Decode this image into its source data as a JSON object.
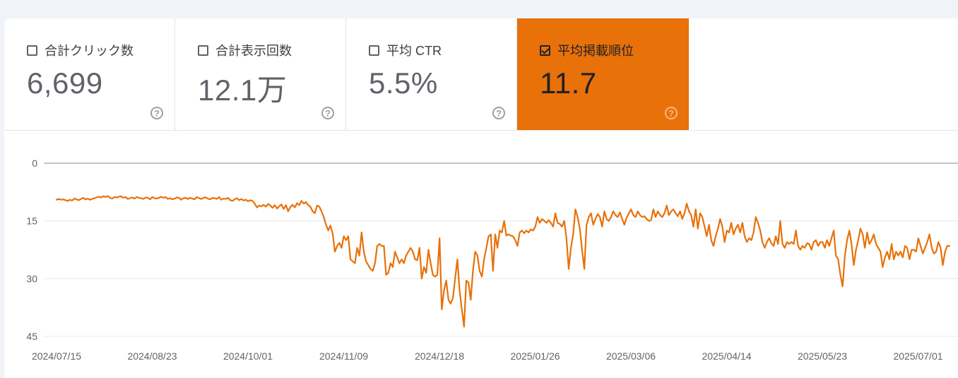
{
  "tiles": [
    {
      "label": "合計クリック数",
      "value": "6,699",
      "checked": false
    },
    {
      "label": "合計表示回数",
      "value": "12.1万",
      "checked": false
    },
    {
      "label": "平均 CTR",
      "value": "5.5%",
      "checked": false
    },
    {
      "label": "平均掲載順位",
      "value": "11.7",
      "checked": true
    }
  ],
  "help_glyph": "?",
  "colors": {
    "accent": "#e8710a",
    "line": "#e8710a"
  },
  "chart_data": {
    "type": "line",
    "title": "",
    "xlabel": "",
    "ylabel": "",
    "y_reversed": true,
    "ylim": [
      0,
      45
    ],
    "y_ticks": [
      "0",
      "15",
      "30",
      "45"
    ],
    "x_ticks": [
      "2024/07/15",
      "2024/08/23",
      "2024/10/01",
      "2024/11/09",
      "2024/12/18",
      "2025/01/26",
      "2025/03/06",
      "2025/04/14",
      "2025/05/23",
      "2025/07/01"
    ],
    "grid": true,
    "series": [
      {
        "values": [
          9.5,
          9.3,
          9.5,
          9.4,
          9.6,
          9.8,
          9.5,
          9.7,
          9.2,
          9.4,
          9.6,
          9.3,
          9.0,
          9.4,
          9.2,
          9.5,
          9.3,
          9.1,
          8.9,
          8.7,
          8.9,
          8.6,
          8.8,
          8.5,
          9.0,
          9.2,
          8.8,
          8.9,
          8.7,
          8.6,
          9.0,
          8.8,
          9.3,
          9.1,
          8.9,
          9.2,
          8.8,
          9.0,
          9.1,
          9.3,
          8.9,
          9.0,
          9.4,
          8.8,
          9.1,
          9.2,
          9.0,
          8.7,
          9.0,
          8.8,
          9.3,
          9.1,
          9.4,
          9.2,
          8.9,
          9.0,
          9.5,
          9.1,
          9.0,
          9.3,
          9.0,
          9.2,
          9.4,
          8.8,
          9.1,
          9.3,
          9.0,
          8.9,
          9.2,
          9.4,
          9.0,
          9.1,
          9.3,
          8.8,
          9.5,
          9.2,
          9.3,
          9.0,
          9.6,
          9.8,
          9.4,
          9.1,
          9.6,
          9.3,
          9.7,
          9.5,
          9.9,
          9.6,
          9.8,
          10.5,
          11.5,
          11.0,
          11.2,
          10.8,
          11.3,
          10.6,
          11.0,
          11.6,
          10.9,
          11.8,
          11.2,
          10.7,
          11.9,
          10.9,
          12.5,
          11.4,
          10.8,
          11.5,
          10.4,
          10.9,
          9.8,
          10.5,
          10.1,
          10.9,
          11.3,
          12.5,
          13.0,
          11.0,
          11.3,
          12.5,
          14.0,
          16.0,
          17.5,
          16.2,
          18.3,
          23.0,
          21.5,
          20.7,
          22.0,
          19.0,
          20.0,
          19.0,
          25.0,
          25.5,
          26.0,
          22.0,
          24.0,
          18.0,
          23.0,
          25.5,
          26.5,
          27.5,
          28.0,
          26.0,
          21.5,
          21.0,
          21.5,
          21.5,
          29.0,
          28.5,
          26.0,
          27.0,
          23.0,
          24.5,
          26.0,
          25.0,
          26.0,
          24.0,
          23.0,
          22.0,
          23.0,
          25.0,
          25.2,
          22.0,
          30.0,
          27.0,
          28.5,
          22.5,
          26.0,
          29.0,
          29.5,
          29.0,
          19.5,
          38.0,
          33.0,
          30.5,
          35.5,
          36.5,
          35.0,
          30.0,
          25.0,
          33.0,
          38.0,
          42.5,
          30.5,
          31.0,
          35.5,
          28.0,
          23.0,
          24.0,
          28.0,
          29.5,
          25.0,
          22.0,
          19.0,
          18.5,
          28.0,
          18.5,
          22.0,
          17.5,
          18.0,
          15.0,
          18.8,
          18.5,
          18.8,
          19.0,
          20.0,
          21.5,
          18.0,
          17.5,
          18.2,
          17.5,
          18.0,
          17.2,
          17.5,
          16.5,
          14.0,
          15.5,
          14.5,
          15.0,
          15.5,
          14.8,
          15.5,
          16.5,
          13.0,
          15.5,
          15.8,
          16.5,
          15.0,
          19.5,
          27.5,
          22.0,
          18.5,
          12.0,
          14.0,
          17.0,
          22.5,
          27.5,
          16.0,
          14.0,
          13.0,
          16.0,
          14.5,
          13.2,
          14.0,
          16.5,
          12.5,
          14.5,
          15.0,
          14.0,
          12.5,
          13.5,
          14.0,
          12.8,
          14.5,
          16.0,
          14.2,
          13.0,
          12.0,
          13.5,
          14.0,
          12.5,
          13.5,
          14.0,
          13.8,
          14.5,
          15.0,
          14.8,
          12.0,
          14.0,
          12.5,
          13.5,
          14.0,
          13.0,
          11.0,
          13.5,
          12.5,
          12.0,
          13.0,
          13.8,
          12.5,
          14.5,
          13.0,
          10.5,
          12.5,
          13.5,
          16.5,
          12.0,
          17.0,
          13.0,
          14.0,
          16.5,
          19.0,
          16.0,
          20.0,
          21.5,
          19.0,
          17.0,
          14.5,
          16.5,
          20.5,
          17.5,
          18.0,
          15.5,
          18.5,
          17.0,
          16.0,
          18.0,
          15.5,
          19.0,
          20.5,
          19.5,
          20.0,
          18.0,
          14.0,
          15.5,
          17.5,
          20.5,
          22.0,
          20.5,
          19.5,
          20.8,
          21.5,
          19.0,
          21.0,
          15.0,
          21.0,
          22.0,
          20.5,
          21.0,
          20.5,
          21.0,
          17.5,
          21.5,
          22.5,
          21.5,
          22.0,
          20.8,
          21.0,
          22.5,
          20.5,
          20.0,
          21.5,
          20.5,
          20.5,
          22.0,
          20.0,
          21.5,
          19.5,
          17.5,
          24.0,
          25.0,
          29.0,
          32.0,
          24.0,
          20.0,
          17.5,
          21.0,
          26.5,
          22.5,
          20.0,
          17.0,
          18.5,
          22.0,
          18.0,
          21.0,
          20.0,
          18.5,
          21.0,
          22.0,
          23.0,
          27.0,
          24.5,
          23.0,
          25.0,
          21.0,
          25.0,
          23.0,
          24.0,
          23.0,
          24.5,
          21.5,
          22.0,
          25.0,
          22.5,
          22.5,
          23.0,
          19.5,
          21.5,
          23.5,
          22.0,
          20.5,
          18.5,
          22.0,
          23.5,
          23.0,
          20.5,
          22.0,
          26.5,
          23.0,
          21.5,
          21.5
        ]
      }
    ]
  }
}
